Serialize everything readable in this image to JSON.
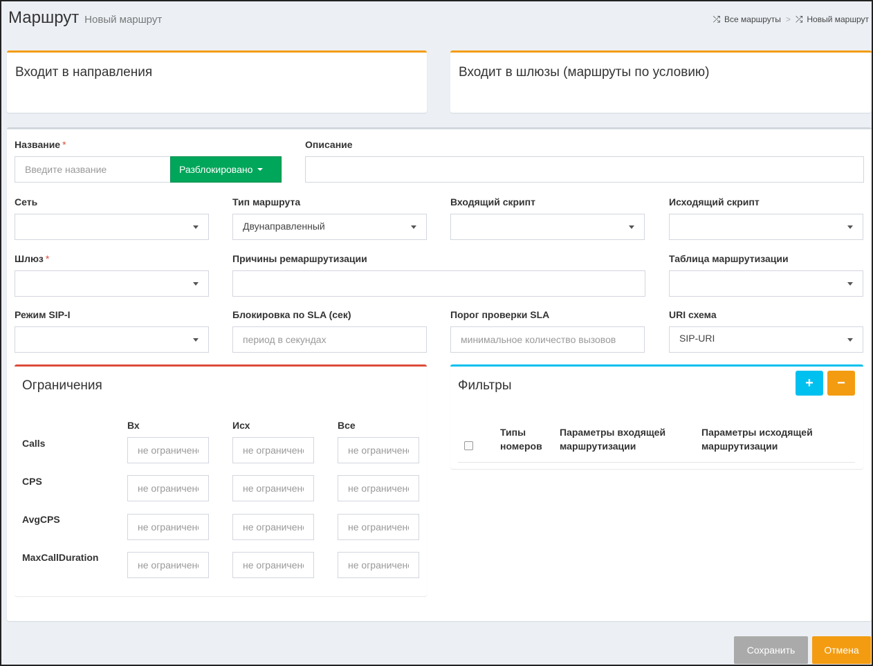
{
  "header": {
    "title": "Маршрут",
    "subtitle": "Новый маршрут",
    "breadcrumb": [
      {
        "label": "Все маршруты",
        "icon": "shuffle-icon"
      },
      {
        "label": "Новый маршрут",
        "icon": "shuffle-icon"
      }
    ],
    "breadcrumb_separator": ">"
  },
  "panels": {
    "directions_title": "Входит в направления",
    "gateways_title": "Входит в шлюзы (маршруты по условию)"
  },
  "form": {
    "name_label": "Название",
    "required_mark": "*",
    "name_placeholder": "Введите название",
    "lock_button": "Разблокировано",
    "description_label": "Описание",
    "network_label": "Сеть",
    "route_type_label": "Тип маршрута",
    "route_type_value": "Двунаправленный",
    "incoming_script_label": "Входящий скрипт",
    "outgoing_script_label": "Исходящий скрипт",
    "gateway_label": "Шлюз",
    "reroute_reasons_label": "Причины ремаршрутизации",
    "routing_table_label": "Таблица маршрутизации",
    "sipi_mode_label": "Режим SIP-I",
    "sla_block_label": "Блокировка по SLA (сек)",
    "sla_block_placeholder": "период в секундах",
    "sla_threshold_label": "Порог проверки SLA",
    "sla_threshold_placeholder": "минимальное количество вызовов",
    "uri_scheme_label": "URI схема",
    "uri_scheme_value": "SIP-URI"
  },
  "limits": {
    "title": "Ограничения",
    "columns": [
      "Вх",
      "Исх",
      "Все"
    ],
    "rows": [
      "Calls",
      "CPS",
      "AvgCPS",
      "MaxCallDuration"
    ],
    "placeholder": "не ограничено"
  },
  "filters": {
    "title": "Фильтры",
    "add_label": "+",
    "remove_label": "−",
    "columns": [
      "Типы номеров",
      "Параметры входящей маршрутизации",
      "Параметры исходящей маршрутизации"
    ]
  },
  "footer": {
    "save_label": "Сохранить",
    "cancel_label": "Отмена"
  },
  "colors": {
    "accent_orange": "#f39c12",
    "success_green": "#00a65a",
    "info_cyan": "#00c0ef",
    "danger_red": "#dd4b39",
    "disabled_gray": "#aaaaaa"
  }
}
